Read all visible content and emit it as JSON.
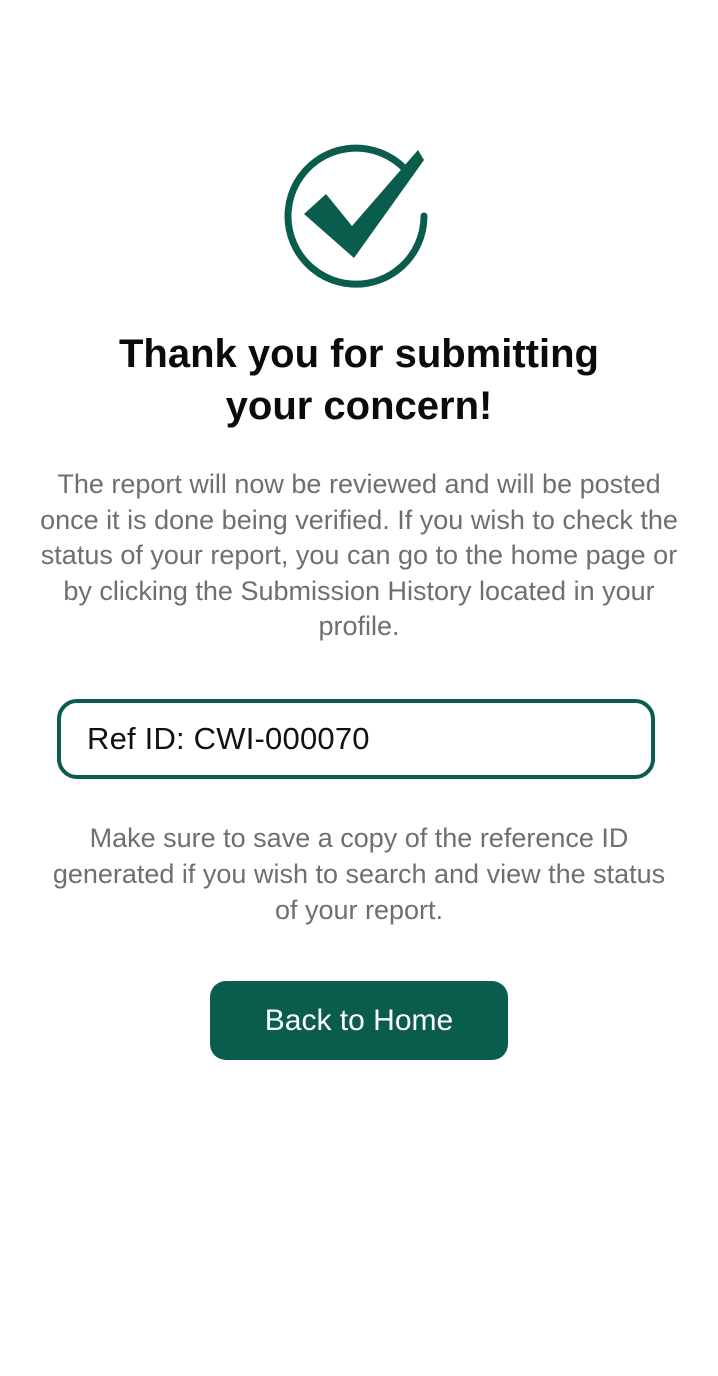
{
  "colors": {
    "accent": "#0a5c4c",
    "title": "#0b0b0b",
    "body_text": "#6f6f6f",
    "background": "#ffffff"
  },
  "icon": {
    "name": "checkmark-circle-icon"
  },
  "title": {
    "line1": "Thank you for submitting",
    "line2": "your concern!"
  },
  "description": "The report will now be reviewed and will be posted once it is done being verified. If you wish to check the status of your report, you can go to the home page or by clicking the Submission History located in your profile.",
  "reference": {
    "text": "Ref ID: CWI-000070"
  },
  "note": "Make sure to save a copy of the reference ID generated if you wish to search and view the status of your report.",
  "button": {
    "label": "Back to Home"
  }
}
